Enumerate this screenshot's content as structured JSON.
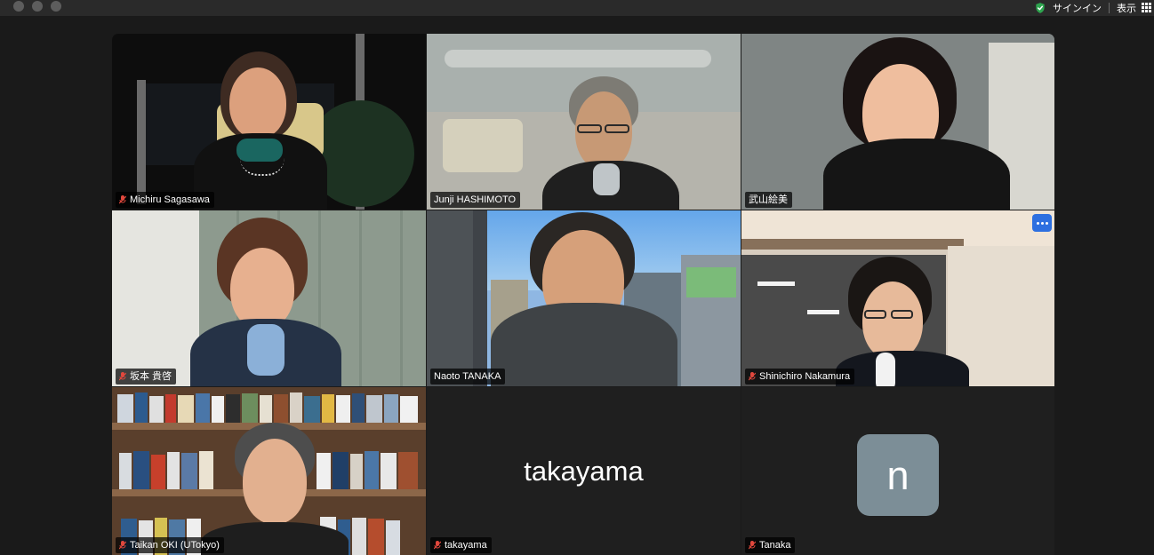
{
  "titlebar": {
    "signin_label": "サインイン",
    "view_label": "表示",
    "icons": [
      "shield-check-icon",
      "grid-icon"
    ]
  },
  "participants": [
    {
      "name": "Michiru Sagasawa",
      "muted": true
    },
    {
      "name": "Junji HASHIMOTO",
      "muted": false
    },
    {
      "name": "武山絵美",
      "muted": false
    },
    {
      "name": "坂本 貴啓",
      "muted": true
    },
    {
      "name": "Naoto TANAKA",
      "muted": false
    },
    {
      "name": "Shinichiro Nakamura",
      "muted": true
    },
    {
      "name": "Taikan OKI (UTokyo)",
      "muted": true
    },
    {
      "name": "takayama",
      "muted": true,
      "display_name": "takayama"
    },
    {
      "name": "Tanaka",
      "muted": true,
      "avatar_letter": "n"
    }
  ],
  "colors": {
    "accent": "#2d6fe0",
    "avatar_bg": "#7c8e97",
    "mute": "#e0483d",
    "shield": "#2ea44f"
  }
}
